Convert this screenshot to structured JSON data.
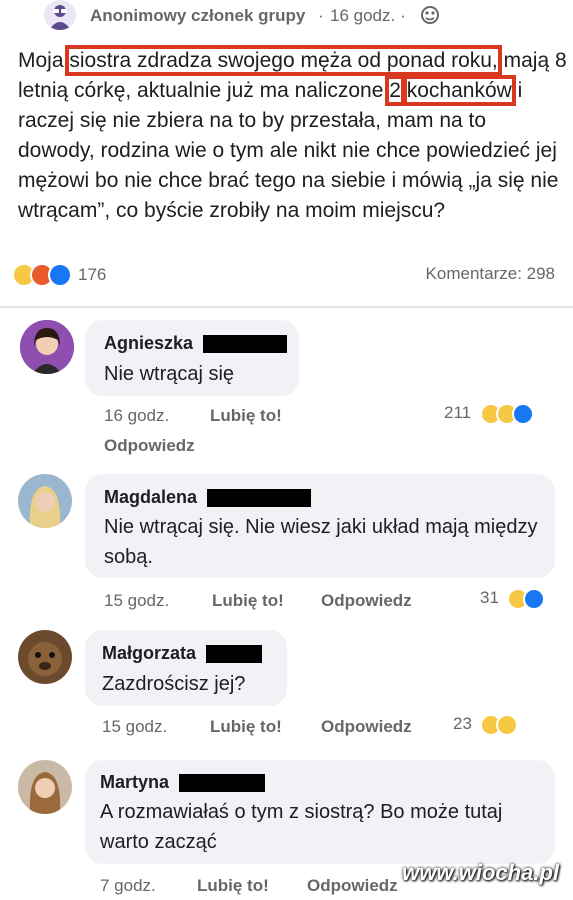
{
  "header": {
    "author": "Anonimowy członek grupy",
    "dot": "·",
    "time": "16 godz. ·"
  },
  "post": {
    "t1": "Moja ",
    "h1": "siostra zdradza swojego męża od ponad roku,",
    "t2": " mają 8 letnią córkę, aktualnie już ma naliczone ",
    "h2": "2",
    "h3": "kochanków",
    "t3": " i raczej się nie zbiera na to by przestała, mam na to dowody, rodzina wie o tym ale nikt nie chce powiedzieć jej mężowi bo nie chce brać tego na siebie i mówią „ja się nie wtrącam”, co byście zrobiły na moim miejscu?",
    "reaction_count": "176",
    "comments_count": "Komentarze: 298"
  },
  "comments": [
    {
      "name": "Agnieszka",
      "text": "Nie wtrącaj się",
      "time": "16 godz.",
      "like": "Lubię to!",
      "reply": "Odpowiedz",
      "count": "211"
    },
    {
      "name": "Magdalena",
      "text": "Nie wtrącaj się. Nie wiesz jaki układ mają między sobą.",
      "time": "15 godz.",
      "like": "Lubię to!",
      "reply": "Odpowiedz",
      "count": "31"
    },
    {
      "name": "Małgorzata",
      "text": "Zazdrościsz jej?",
      "time": "15 godz.",
      "like": "Lubię to!",
      "reply": "Odpowiedz",
      "count": "23"
    },
    {
      "name": "Martyna",
      "text": "A rozmawiałaś o tym z siostrą? Bo może tutaj warto zacząć",
      "time": "7 godz.",
      "like": "Lubię to!",
      "reply": "Odpowiedz",
      "count": ""
    }
  ],
  "watermark": "www.wiocha.pl",
  "colors": {
    "highlight": "#d9381e",
    "bubble": "#f0f2f5",
    "meta": "#65676b",
    "like_blue": "#1877f2"
  }
}
